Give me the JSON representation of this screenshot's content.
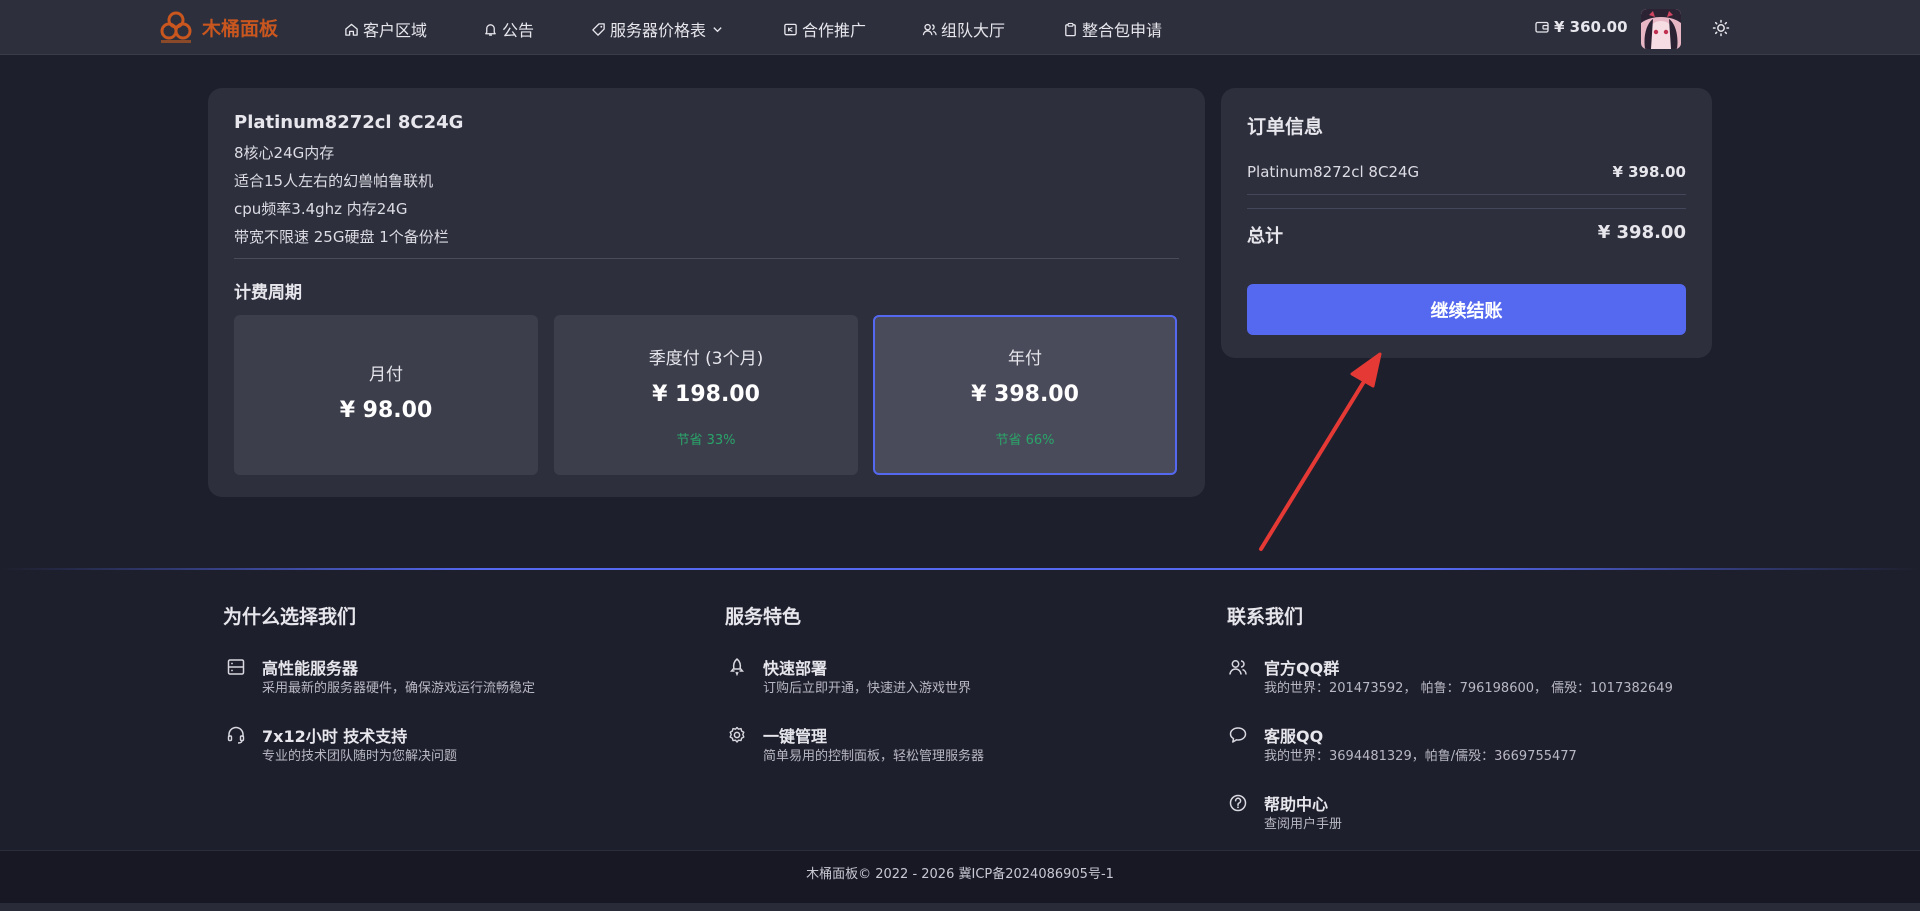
{
  "nav": {
    "brand": "木桶面板",
    "items": [
      {
        "label": "客户区域",
        "icon": "home-icon"
      },
      {
        "label": "公告",
        "icon": "bell-icon"
      },
      {
        "label": "服务器价格表",
        "icon": "tag-icon"
      },
      {
        "label": "合作推广",
        "icon": "share-icon"
      },
      {
        "label": "组队大厅",
        "icon": "users-icon"
      },
      {
        "label": "整合包申请",
        "icon": "clipboard-icon"
      }
    ],
    "balance": "¥ 360.00"
  },
  "product": {
    "title": "Platinum8272cl 8C24G",
    "description": [
      "8核心24G内存",
      "适合15人左右的幻兽帕鲁联机",
      "cpu频率3.4ghz 内存24G",
      "带宽不限速 25G硬盘 1个备份栏"
    ],
    "cycle_title": "计费周期",
    "cycles": [
      {
        "name": "月付",
        "price": "¥ 98.00",
        "saving": ""
      },
      {
        "name": "季度付 (3个月)",
        "price": "¥ 198.00",
        "saving": "节省 33%"
      },
      {
        "name": "年付",
        "price": "¥ 398.00",
        "saving": "节省 66%"
      }
    ]
  },
  "order": {
    "title": "订单信息",
    "item_name": "Platinum8272cl 8C24G",
    "item_price": "¥ 398.00",
    "total_label": "总计",
    "total_value": "¥ 398.00",
    "checkout_label": "继续结账"
  },
  "footer": {
    "columns": [
      {
        "title": "为什么选择我们",
        "items": [
          {
            "title": "高性能服务器",
            "desc": "采用最新的服务器硬件，确保游戏运行流畅稳定",
            "icon": "server-icon"
          },
          {
            "title": "7x12小时 技术支持",
            "desc": "专业的技术团队随时为您解决问题",
            "icon": "headset-icon"
          }
        ]
      },
      {
        "title": "服务特色",
        "items": [
          {
            "title": "快速部署",
            "desc": "订购后立即开通，快速进入游戏世界",
            "icon": "rocket-icon"
          },
          {
            "title": "一键管理",
            "desc": "简单易用的控制面板，轻松管理服务器",
            "icon": "gear-icon"
          }
        ]
      },
      {
        "title": "联系我们",
        "items": [
          {
            "title": "官方QQ群",
            "desc": "我的世界：201473592， 帕鲁：796198600， 儒殁：1017382649",
            "icon": "users-icon"
          },
          {
            "title": "客服QQ",
            "desc": "我的世界：3694481329，帕鲁/儒殁：3669755477",
            "icon": "chat-icon"
          },
          {
            "title": "帮助中心",
            "desc": "查阅用户手册",
            "icon": "help-icon"
          }
        ]
      }
    ],
    "copyright": "木桶面板© 2022 - 2026 冀ICP备2024086905号-1"
  },
  "colors": {
    "accent": "#5468f0",
    "brand": "#c8561e",
    "saving": "#2aa56a",
    "annotation_arrow": "#e53935"
  }
}
